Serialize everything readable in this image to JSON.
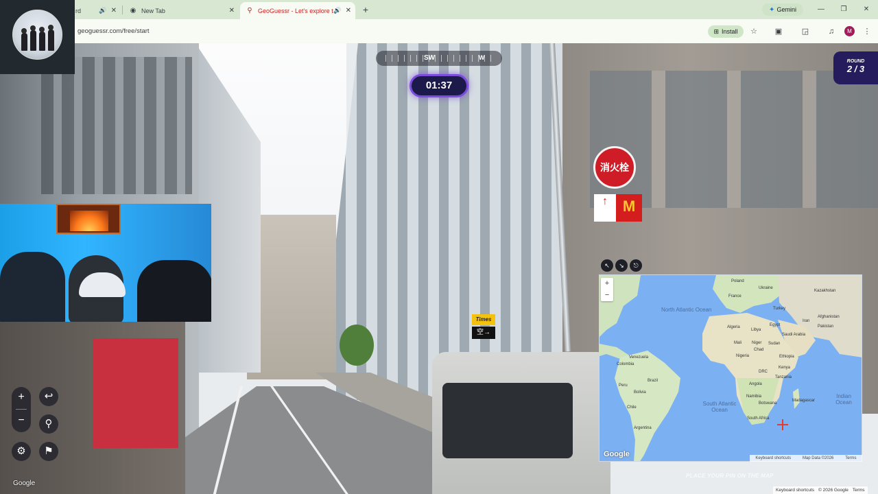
{
  "browser": {
    "tabs": [
      {
        "title": "rd",
        "active": false
      },
      {
        "title": "New Tab",
        "active": false
      },
      {
        "title": "GeoGuessr - Let's explore the",
        "active": true
      }
    ],
    "gemini_label": "Gemini",
    "url": "geoguessr.com/free/start",
    "install_label": "Install",
    "profile_initial": "M"
  },
  "game": {
    "compass": {
      "sw": "SW",
      "w": "W"
    },
    "timer": "01:37",
    "round": {
      "label": "ROUND",
      "value": "2 / 3"
    },
    "place_pin_text": "PLACE YOUR PIN ON THE MAP",
    "sv_google": "Google"
  },
  "street_signs": {
    "fire_hydrant": "消火栓",
    "times_top": "Times",
    "times_bottom": "空→"
  },
  "minimap": {
    "oceans": [
      "North Atlantic Ocean",
      "South Atlantic Ocean",
      "Indian Ocean"
    ],
    "countries": [
      "Poland",
      "Ukraine",
      "Kazakhstan",
      "France",
      "Turkey",
      "Iran",
      "Afghanistan",
      "Pakistan",
      "Algeria",
      "Libya",
      "Egypt",
      "Saudi Arabia",
      "Mali",
      "Niger",
      "Sudan",
      "Chad",
      "Nigeria",
      "Ethiopia",
      "Kenya",
      "DRC",
      "Tanzania",
      "Angola",
      "Namibia",
      "Botswana",
      "South Africa",
      "Madagascar",
      "Venezuela",
      "Colombia",
      "Brazil",
      "Peru",
      "Bolivia",
      "Chile",
      "Argentina"
    ],
    "google_logo": "Google",
    "attribution": [
      "Keyboard shortcuts",
      "Map Data ©2026",
      "Terms"
    ]
  },
  "footer": [
    "Keyboard shortcuts",
    "© 2026 Google",
    "Terms"
  ]
}
